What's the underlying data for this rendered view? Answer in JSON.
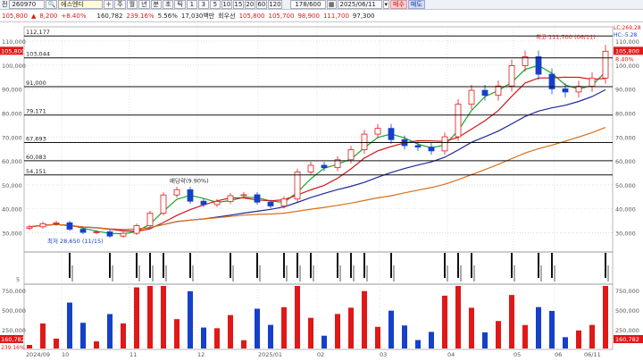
{
  "toolbar_top": {
    "code": "260970",
    "name": "에스엔디",
    "items": [
      "주",
      "월",
      "년",
      "분",
      "초",
      "틱"
    ],
    "periods": [
      "1",
      "3",
      "5",
      "10",
      "15",
      "20",
      "60",
      "120"
    ],
    "count": "178/600",
    "date": "2025/06/11",
    "buy_label": "매수",
    "sell_label": "매도",
    "prefix_label": "전"
  },
  "toolbar_info": {
    "price": "105,800",
    "change": "8,200",
    "change_pct": "+8.40%",
    "turnover": "239.16%",
    "amount": "160,782",
    "rate2": "5.56%",
    "volume_text": "17,030백만",
    "vwap_label": "회우선",
    "open": "105,800",
    "high": "105,700",
    "low_a": "98,900",
    "low_b": "111,700",
    "extra": "97,300"
  },
  "price_axis": {
    "ticks": [
      "110,000",
      "100,000",
      "90,000",
      "80,000",
      "70,000",
      "60,000",
      "50,000",
      "40,000",
      "30,000"
    ],
    "current": "105,800",
    "current_pct": "8.40%",
    "hl_top": "LC:269,28",
    "hl_bottom": "HC:-5.28"
  },
  "left_axis_ticks": [
    "110,000",
    "100,000",
    "90,000",
    "80,000",
    "70,000",
    "60,000",
    "50,000",
    "40,000",
    "30,000"
  ],
  "hlines": [
    "112,177",
    "103,044",
    "91,000",
    "79,171",
    "67,693",
    "60,083",
    "54,151"
  ],
  "annotations": {
    "high": "최고 111,700 (06/11)",
    "low": "최저 28,650 (11/15)",
    "mid": "배당락(9.90%)"
  },
  "signal_axis": {
    "tick": "5"
  },
  "volume_axis": {
    "ticks": [
      "750,000",
      "500,000",
      "250,000"
    ],
    "current": "160,782",
    "current_pct": "239.16%"
  },
  "date_axis": [
    "2024/09",
    "10",
    "11",
    "12",
    "2025/01",
    "02",
    "03",
    "04",
    "05",
    "06",
    "06/11"
  ],
  "colors": {
    "up": "#e01818",
    "down": "#1540c9",
    "ma5": "#1aa52a",
    "ma20": "#d01818",
    "ma60": "#1a2a9a",
    "ma120": "#d8701a"
  },
  "chart_data": {
    "type": "candlestick",
    "x_range": [
      "2024/09",
      "2025/06/11"
    ],
    "ylim": [
      22000,
      116000
    ],
    "series": [
      {
        "name": "종가",
        "values": [
          32500,
          33800,
          34200,
          31500,
          30200,
          30400,
          28650,
          29800,
          33000,
          38200,
          45800,
          48000,
          43200,
          41800,
          43100,
          45500,
          45900,
          42800,
          41200,
          44100,
          55400,
          58200,
          57200,
          60500,
          64700,
          71200,
          73600,
          68900,
          66400,
          65800,
          64200,
          70100,
          83700,
          89500,
          87400,
          91300,
          99800,
          103500,
          96200,
          90100,
          88800,
          91200,
          94600,
          105800
        ]
      }
    ]
  }
}
